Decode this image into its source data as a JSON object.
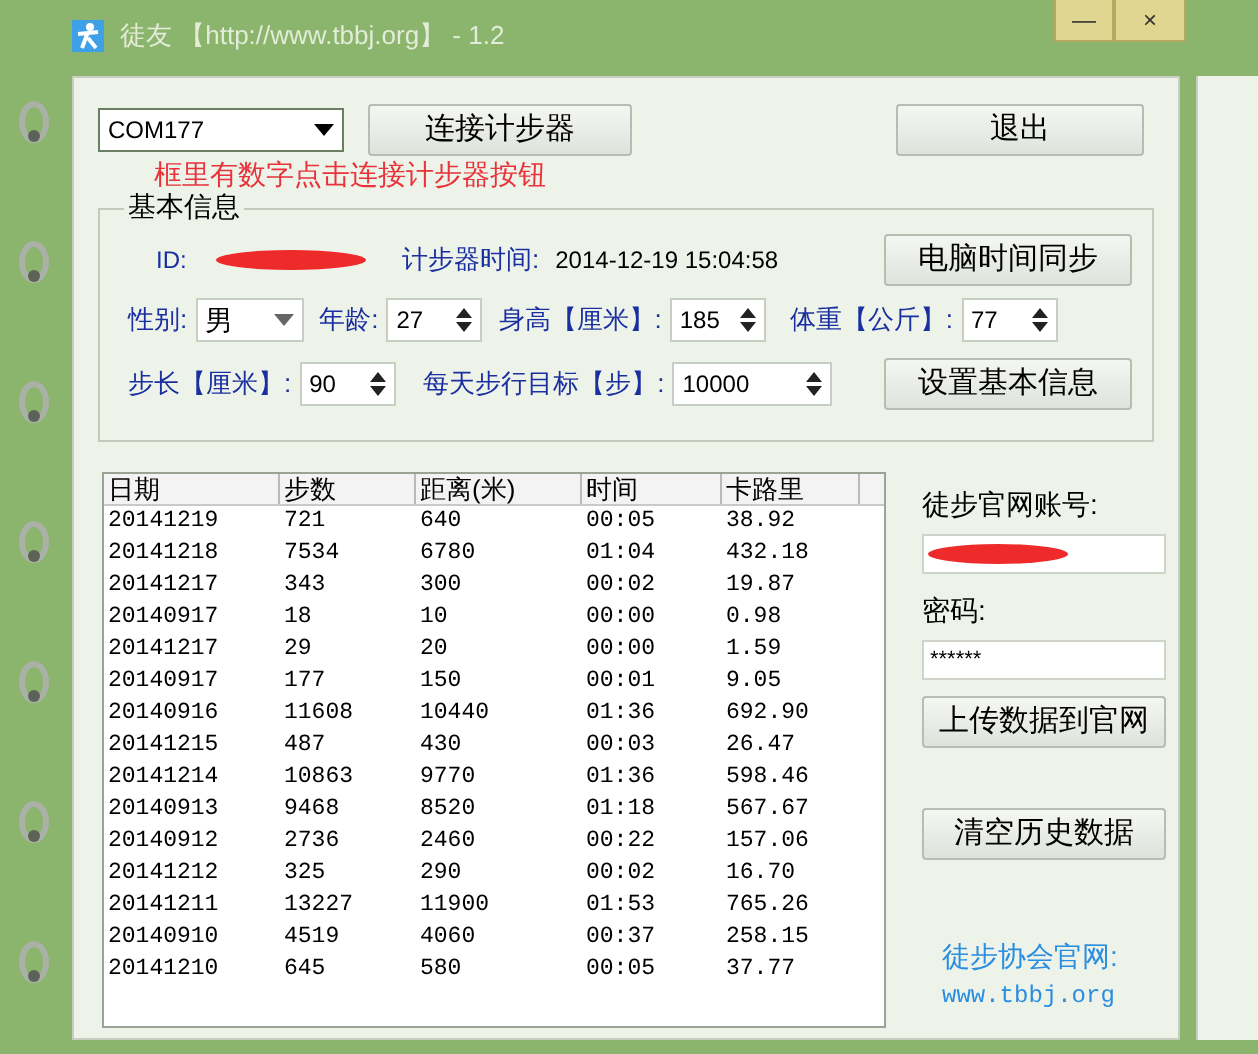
{
  "window": {
    "title": "徒友 【http://www.tbbj.org】 - 1.2",
    "buttons": [
      "—",
      "×"
    ]
  },
  "top": {
    "port": "COM177",
    "connect": "连接计步器",
    "exit": "退出",
    "hint": "框里有数字点击连接计步器按钮"
  },
  "basic": {
    "title": "基本信息",
    "id_label": "ID:",
    "id_redacted": true,
    "time_label": "计步器时间:",
    "time_value": "2014-12-19 15:04:58",
    "sync": "电脑时间同步",
    "fields": [
      {
        "kind": "select",
        "label": "性别:",
        "value": "男"
      },
      {
        "kind": "spin",
        "label": "年龄:",
        "value": "27"
      },
      {
        "kind": "spin",
        "label": "身高【厘米】:",
        "value": "185"
      },
      {
        "kind": "spin",
        "label": "体重【公斤】:",
        "value": "77"
      }
    ],
    "fields2": [
      {
        "kind": "spin",
        "label": "步长【厘米】:",
        "value": "90"
      },
      {
        "kind": "spin",
        "label": "每天步行目标【步】:",
        "value": "10000"
      }
    ],
    "set": "设置基本信息"
  },
  "table": {
    "columns": [
      "日期",
      "步数",
      "距离(米)",
      "时间",
      "卡路里"
    ],
    "rows": [
      [
        "20141219",
        "721",
        "640",
        "00:05",
        "38.92"
      ],
      [
        "20141218",
        "7534",
        "6780",
        "01:04",
        "432.18"
      ],
      [
        "20141217",
        "343",
        "300",
        "00:02",
        "19.87"
      ],
      [
        "20140917",
        "18",
        "10",
        "00:00",
        "0.98"
      ],
      [
        "20141217",
        "29",
        "20",
        "00:00",
        "1.59"
      ],
      [
        "20140917",
        "177",
        "150",
        "00:01",
        "9.05"
      ],
      [
        "20140916",
        "11608",
        "10440",
        "01:36",
        "692.90"
      ],
      [
        "20141215",
        "487",
        "430",
        "00:03",
        "26.47"
      ],
      [
        "20141214",
        "10863",
        "9770",
        "01:36",
        "598.46"
      ],
      [
        "20140913",
        "9468",
        "8520",
        "01:18",
        "567.67"
      ],
      [
        "20140912",
        "2736",
        "2460",
        "00:22",
        "157.06"
      ],
      [
        "20141212",
        "325",
        "290",
        "00:02",
        "16.70"
      ],
      [
        "20141211",
        "13227",
        "11900",
        "01:53",
        "765.26"
      ],
      [
        "20140910",
        "4519",
        "4060",
        "00:37",
        "258.15"
      ],
      [
        "20141210",
        "645",
        "580",
        "00:05",
        "37.77"
      ]
    ]
  },
  "side": {
    "account_label": "徒步官网账号:",
    "account_redacted": true,
    "password_label": "密码:",
    "password": "******",
    "upload": "上传数据到官网",
    "clear": "清空历史数据",
    "site_label": "徒步协会官网:",
    "site_url": "www.tbbj.org"
  }
}
